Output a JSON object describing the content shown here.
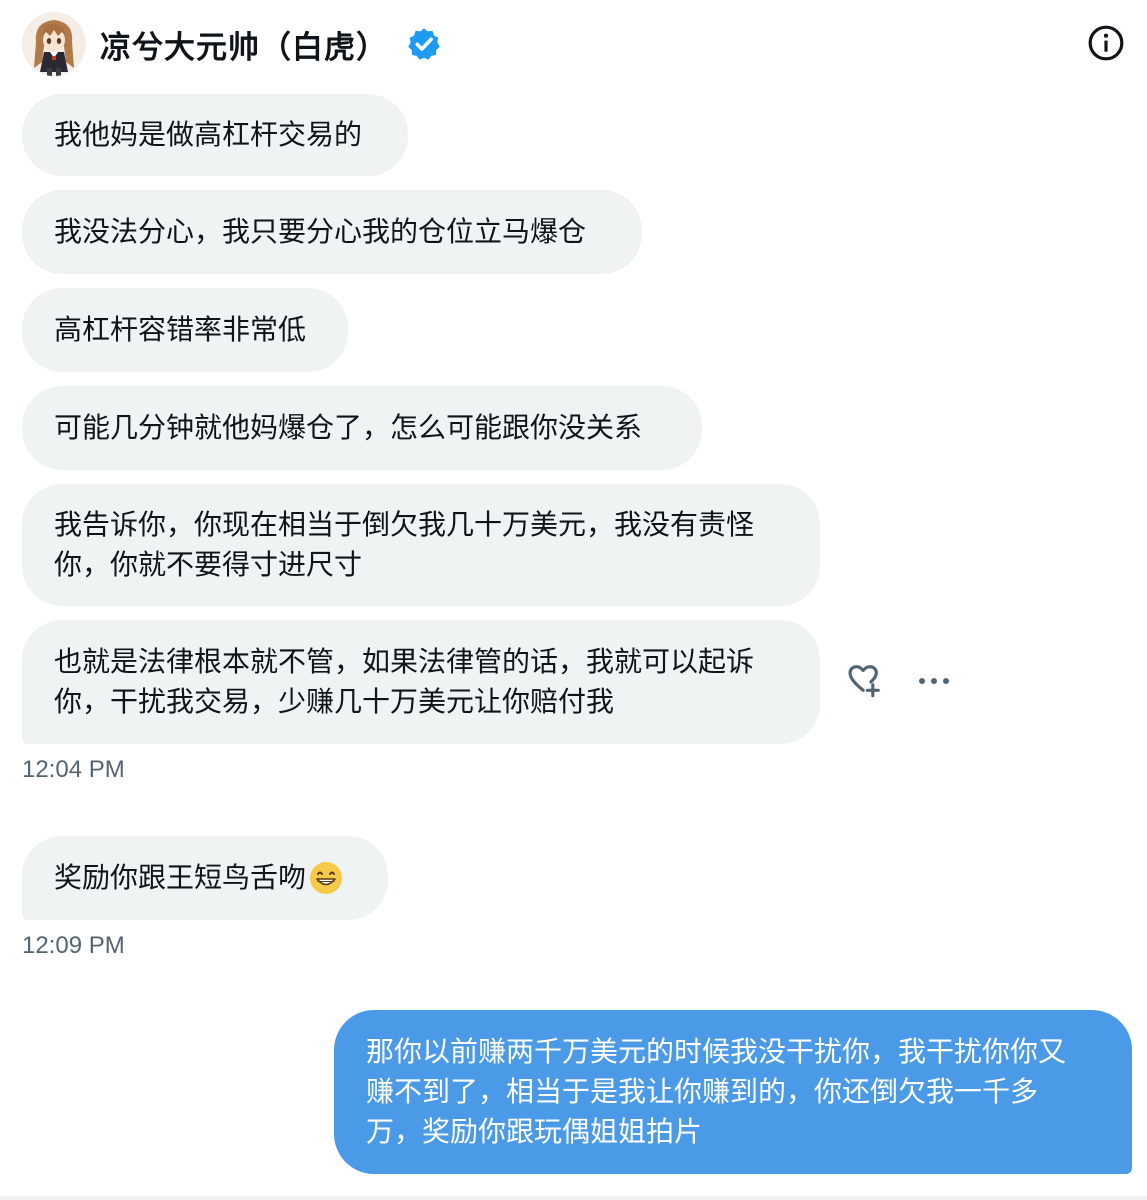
{
  "header": {
    "display_name": "凉兮大元帅（白虎）",
    "verified": true,
    "avatar_icon": "anime-avatar-icon",
    "info_icon": "info-icon"
  },
  "messages": [
    {
      "direction": "in",
      "lines": [
        "我他妈是做高杠杆交易的"
      ]
    },
    {
      "direction": "in",
      "lines": [
        "我没法分心，我只要分心我的仓位立马爆仓"
      ]
    },
    {
      "direction": "in",
      "lines": [
        "高杠杆容错率非常低"
      ]
    },
    {
      "direction": "in",
      "lines": [
        "可能几分钟就他妈爆仓了，怎么可能跟你没关系"
      ]
    },
    {
      "direction": "in",
      "lines": [
        "我告诉你，你现在相当于倒欠我几十万美元，我没有责怪",
        "你，你就不要得寸进尺寸"
      ]
    },
    {
      "direction": "in",
      "lines": [
        "也就是法律根本就不管，如果法律管的话，我就可以起诉",
        "你，干扰我交易，少赚几十万美元让你赔付我"
      ]
    },
    {
      "direction": "in",
      "lines": [
        "奖励你跟王短鸟舌吻"
      ],
      "emoji": "grinning-face-emoji"
    },
    {
      "direction": "out",
      "lines": [
        "那你以前赚两千万美元的时候我没干扰你，我干扰你你又",
        "赚不到了，相当于是我让你赚到的，你还倒欠我一千多",
        "万，奖励你跟玩偶姐姐拍片"
      ]
    }
  ],
  "timestamps": [
    "12:04 PM",
    "12:09 PM"
  ],
  "colors": {
    "incoming_bubble": "#eff3f4",
    "outgoing_bubble": "#4b9ae8",
    "verified_badge": "#1d9bf0",
    "timestamp_text": "#536471"
  }
}
